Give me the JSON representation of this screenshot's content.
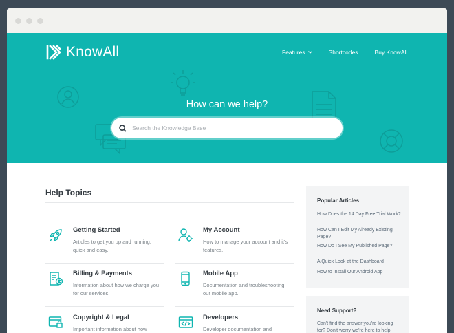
{
  "brand": {
    "name": "KnowAll"
  },
  "nav": {
    "items": [
      {
        "label": "Features"
      },
      {
        "label": "Shortcodes"
      },
      {
        "label": "Buy KnowAll"
      }
    ]
  },
  "hero": {
    "title": "How can we help?"
  },
  "search": {
    "placeholder": "Search the Knowledge Base"
  },
  "help_topics": {
    "title": "Help Topics",
    "items": [
      {
        "title": "Getting Started",
        "description": "Articles to get you up and running, quick and easy.",
        "icon": "rocket-icon"
      },
      {
        "title": "My Account",
        "description": "How to manage your account and it's features.",
        "icon": "user-gear-icon"
      },
      {
        "title": "Billing & Payments",
        "description": "Information about how we charge you for our services.",
        "icon": "invoice-icon"
      },
      {
        "title": "Mobile App",
        "description": "Documentation and troubleshooting our mobile app.",
        "icon": "mobile-phone-icon"
      },
      {
        "title": "Copyright & Legal",
        "description": "Important information about how",
        "icon": "browser-lock-icon"
      },
      {
        "title": "Developers",
        "description": "Developer documentation and",
        "icon": "code-window-icon"
      }
    ]
  },
  "popular_articles": {
    "title": "Popular Articles",
    "items": [
      "How Does the 14 Day Free Trial Work?",
      "How Can I Edit My Already Existing Page?",
      "How Do I See My Published Page?",
      "A Quick Look at the Dashboard",
      "How to Install Our Android App"
    ]
  },
  "support": {
    "title": "Need Support?",
    "text": "Can't find the answer you're looking for? Don't worry we're here to help!"
  },
  "colors": {
    "accent": "#0fb5b0",
    "heading": "#333a40",
    "muted": "#7a8288",
    "link": "#5b6a78"
  }
}
